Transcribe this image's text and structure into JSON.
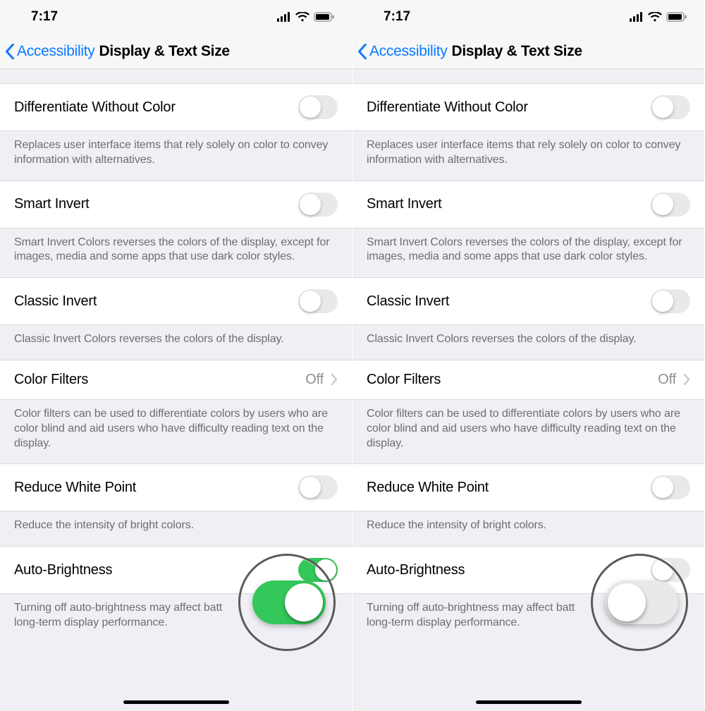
{
  "status": {
    "time": "7:17"
  },
  "nav": {
    "back": "Accessibility",
    "title": "Display & Text Size"
  },
  "rows": {
    "diff": {
      "label": "Differentiate Without Color",
      "footer": "Replaces user interface items that rely solely on color to convey information with alternatives."
    },
    "smart": {
      "label": "Smart Invert",
      "footer": "Smart Invert Colors reverses the colors of the display, except for images, media and some apps that use dark color styles."
    },
    "classic": {
      "label": "Classic Invert",
      "footer": "Classic Invert Colors reverses the colors of the display."
    },
    "filters": {
      "label": "Color Filters",
      "value": "Off",
      "footer": "Color filters can be used to differentiate colors by users who are color blind and aid users who have difficulty reading text on the display."
    },
    "white": {
      "label": "Reduce White Point",
      "footer": "Reduce the intensity of bright colors."
    },
    "auto": {
      "label": "Auto-Brightness",
      "footer_truncated": "Turning off auto-brightness may affect batt\nlong-term display performance."
    }
  },
  "screens": [
    {
      "auto_on": true
    },
    {
      "auto_on": false
    }
  ]
}
